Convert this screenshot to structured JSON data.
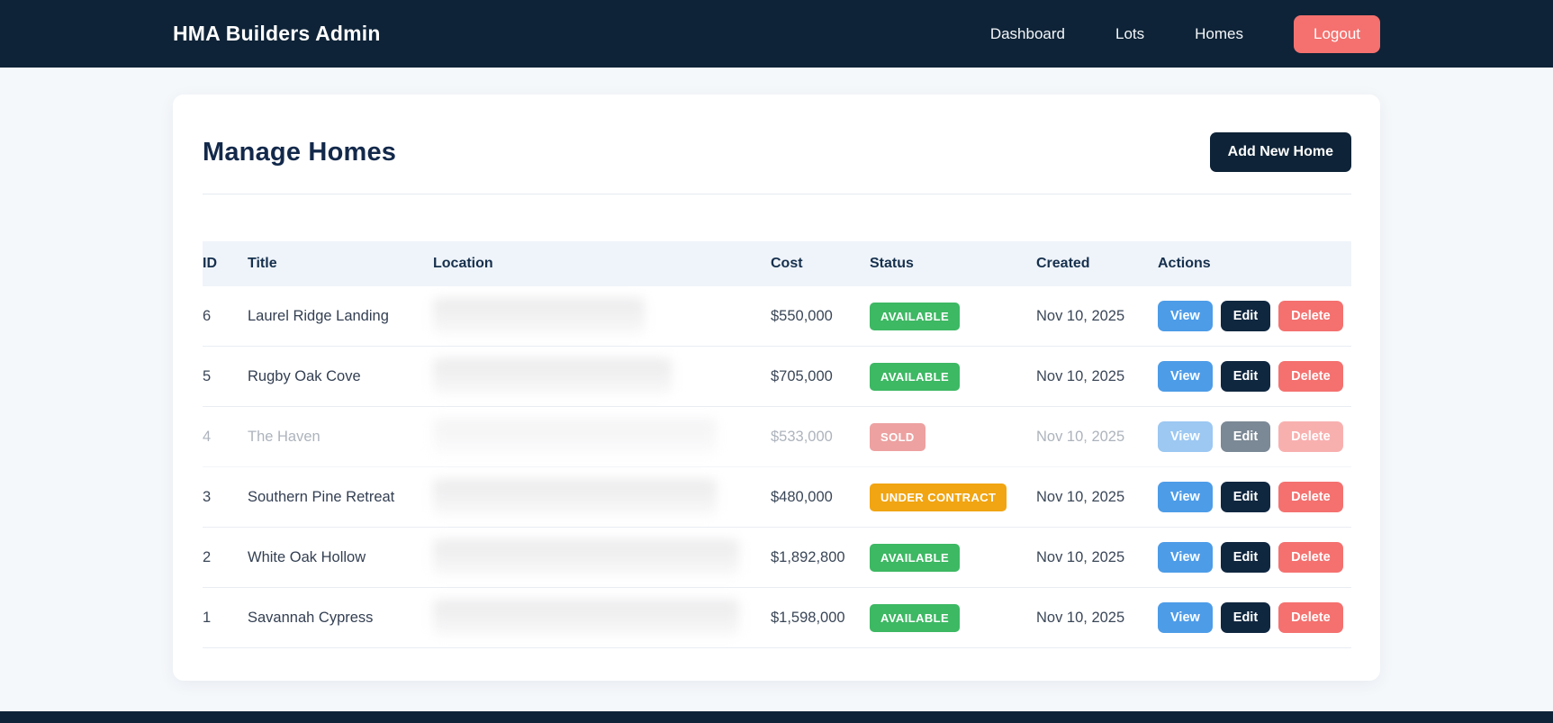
{
  "navbar": {
    "brand": "HMA Builders Admin",
    "links": [
      {
        "label": "Dashboard"
      },
      {
        "label": "Lots"
      },
      {
        "label": "Homes"
      }
    ],
    "logout_label": "Logout"
  },
  "page": {
    "title": "Manage Homes",
    "add_button_label": "Add New Home"
  },
  "table": {
    "columns": [
      "ID",
      "Title",
      "Location",
      "Cost",
      "Status",
      "Created",
      "Actions"
    ],
    "action_labels": {
      "view": "View",
      "edit": "Edit",
      "delete": "Delete"
    },
    "rows": [
      {
        "id": "6",
        "title": "Laurel Ridge Landing",
        "location_redacted": true,
        "cost": "$550,000",
        "status": "AVAILABLE",
        "created": "Nov 10, 2025"
      },
      {
        "id": "5",
        "title": "Rugby Oak Cove",
        "location_redacted": true,
        "cost": "$705,000",
        "status": "AVAILABLE",
        "created": "Nov 10, 2025"
      },
      {
        "id": "4",
        "title": "The Haven",
        "location_redacted": true,
        "cost": "$533,000",
        "status": "SOLD",
        "created": "Nov 10, 2025"
      },
      {
        "id": "3",
        "title": "Southern Pine Retreat",
        "location_redacted": true,
        "cost": "$480,000",
        "status": "UNDER CONTRACT",
        "created": "Nov 10, 2025"
      },
      {
        "id": "2",
        "title": "White Oak Hollow",
        "location_redacted": true,
        "cost": "$1,892,800",
        "status": "AVAILABLE",
        "created": "Nov 10, 2025"
      },
      {
        "id": "1",
        "title": "Savannah Cypress",
        "location_redacted": true,
        "cost": "$1,598,000",
        "status": "AVAILABLE",
        "created": "Nov 10, 2025"
      }
    ]
  },
  "colors": {
    "navbar_bg": "#0e2337",
    "accent_dark": "#102740",
    "status_available": "#3db863",
    "status_sold": "#e05656",
    "status_under_contract": "#f1a512",
    "button_view": "#4d9ce8",
    "button_delete": "#f4716f",
    "logout": "#f4716f",
    "page_bg": "#f5f8fb"
  }
}
